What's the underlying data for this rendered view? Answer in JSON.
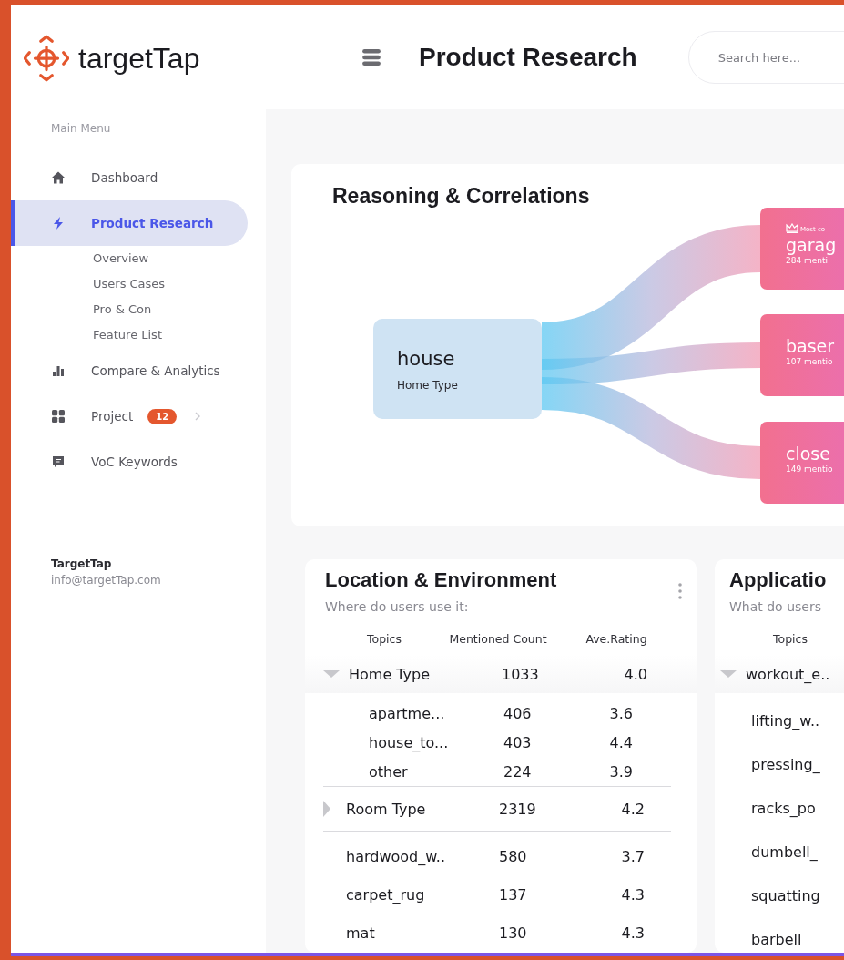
{
  "brand": {
    "name": "targetTap"
  },
  "sidebar": {
    "section_label": "Main Menu",
    "items": [
      {
        "label": "Dashboard",
        "selected": false
      },
      {
        "label": "Product Research",
        "selected": true,
        "children": [
          {
            "label": "Overview"
          },
          {
            "label": "Users Cases"
          },
          {
            "label": "Pro & Con"
          },
          {
            "label": "Feature List"
          }
        ]
      },
      {
        "label": "Compare & Analytics",
        "selected": false
      },
      {
        "label": "Project",
        "selected": false,
        "badge": "12"
      },
      {
        "label": "VoC Keywords",
        "selected": false
      }
    ],
    "footer": {
      "company": "TargetTap",
      "email": "info@targetTap.com"
    }
  },
  "header": {
    "title": "Product Research",
    "search": {
      "placeholder": "Search here..."
    }
  },
  "reasoning": {
    "title": "Reasoning & Correlations",
    "source": {
      "name": "house",
      "category": "Home Type"
    },
    "targets": [
      {
        "name": "garag",
        "mentions": "284 menti",
        "badge": "Most co"
      },
      {
        "name": "baser",
        "mentions": "107 mentio"
      },
      {
        "name": "close",
        "mentions": "149 mentio"
      }
    ]
  },
  "panels": [
    {
      "title": "Location & Environment",
      "subtitle": "Where do users use it:",
      "columns": [
        "Topics",
        "Mentioned Count",
        "Ave.Rating"
      ],
      "rows": [
        {
          "cells": [
            "Home Type",
            "1033",
            "4.0"
          ],
          "expanded": true,
          "children": [
            {
              "cells": [
                "apartme...",
                "406",
                "3.6"
              ]
            },
            {
              "cells": [
                "house_to...",
                "403",
                "4.4"
              ]
            },
            {
              "cells": [
                "other",
                "224",
                "3.9"
              ]
            }
          ]
        },
        {
          "cells": [
            "Room Type",
            "2319",
            "4.2"
          ],
          "expanded": false
        },
        {
          "cells": [
            "hardwood_w..",
            "580",
            "3.7"
          ]
        },
        {
          "cells": [
            "carpet_rug",
            "137",
            "4.3"
          ]
        },
        {
          "cells": [
            "mat",
            "130",
            "4.3"
          ]
        }
      ]
    },
    {
      "title": "Applicatio",
      "subtitle": "What do users",
      "columns": [
        "Topics"
      ],
      "rows": [
        {
          "cells": [
            "workout_e.."
          ],
          "expanded": true,
          "children": [
            {
              "cells": [
                "lifting_w.."
              ]
            },
            {
              "cells": [
                "pressing_"
              ]
            },
            {
              "cells": [
                "racks_po"
              ]
            },
            {
              "cells": [
                "dumbell_"
              ]
            },
            {
              "cells": [
                "squatting"
              ]
            },
            {
              "cells": [
                "barbell"
              ]
            }
          ]
        }
      ]
    }
  ]
}
